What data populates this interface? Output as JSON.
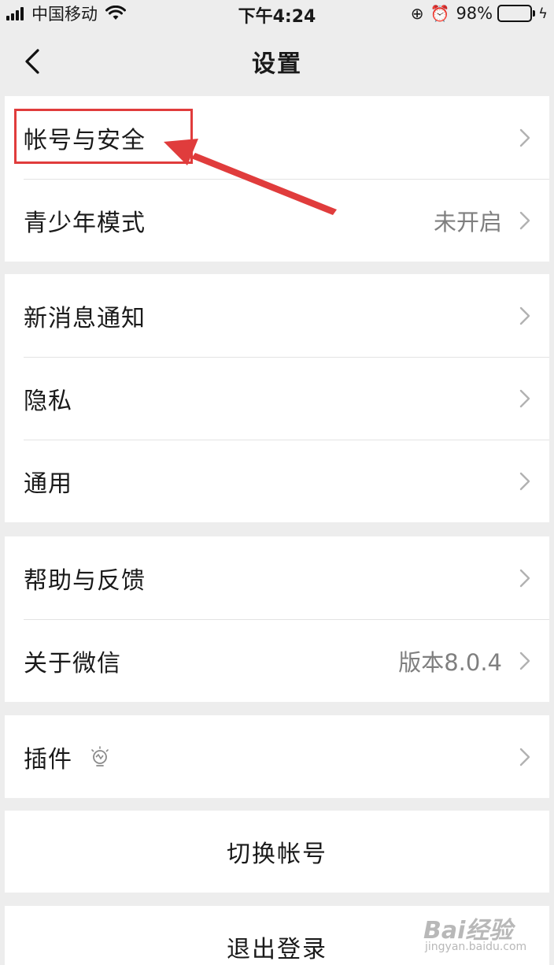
{
  "status_bar": {
    "carrier": "中国移动",
    "time": "下午4:24",
    "battery_percent": "98%",
    "battery_level": 0.98,
    "icons": [
      "signal-icon",
      "wifi-icon",
      "rotation-lock-icon",
      "alarm-icon",
      "battery-icon",
      "charging-bolt-icon"
    ]
  },
  "nav": {
    "title": "设置",
    "back_icon": "chevron-left-icon"
  },
  "groups": [
    {
      "items": [
        {
          "label": "帐号与安全",
          "value": ""
        },
        {
          "label": "青少年模式",
          "value": "未开启"
        }
      ]
    },
    {
      "items": [
        {
          "label": "新消息通知",
          "value": ""
        },
        {
          "label": "隐私",
          "value": ""
        },
        {
          "label": "通用",
          "value": ""
        }
      ]
    },
    {
      "items": [
        {
          "label": "帮助与反馈",
          "value": ""
        },
        {
          "label": "关于微信",
          "value": "版本8.0.4"
        }
      ]
    },
    {
      "items": [
        {
          "label": "插件",
          "value": "",
          "icon": "lightbulb-icon"
        }
      ]
    }
  ],
  "actions": {
    "switch_account": "切换帐号",
    "logout": "退出登录"
  },
  "colors": {
    "background": "#ededed",
    "cell_background": "#ffffff",
    "secondary_text": "#7f7f7f",
    "annotation_red": "#e03c3c",
    "battery_green": "#4cd964"
  },
  "watermark": {
    "brand": "Bai经验",
    "url": "jingyan.baidu.com"
  }
}
